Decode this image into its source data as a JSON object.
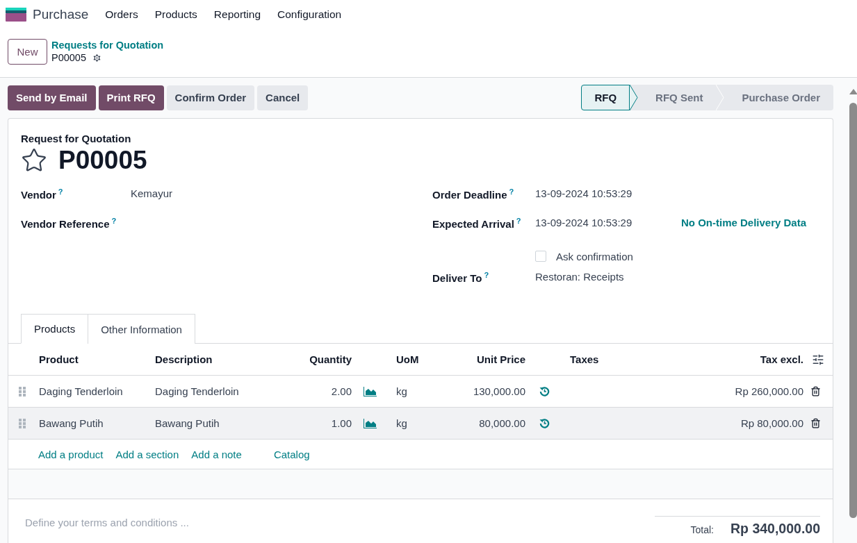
{
  "app": {
    "name": "Purchase"
  },
  "menu": [
    "Orders",
    "Products",
    "Reporting",
    "Configuration"
  ],
  "control_panel": {
    "new_button": "New",
    "breadcrumb": "Requests for Quotation",
    "record": "P00005"
  },
  "actions": [
    {
      "label": "Send by Email",
      "kind": "primary"
    },
    {
      "label": "Print RFQ",
      "kind": "primary"
    },
    {
      "label": "Confirm Order",
      "kind": "secondary"
    },
    {
      "label": "Cancel",
      "kind": "secondary"
    }
  ],
  "status_bar": [
    {
      "label": "RFQ",
      "selected": true
    },
    {
      "label": "RFQ Sent",
      "selected": false
    },
    {
      "label": "Purchase Order",
      "selected": false
    }
  ],
  "form": {
    "subtitle": "Request for Quotation",
    "title": "P00005",
    "starred": false,
    "left_fields": [
      {
        "label": "Vendor",
        "help": "?",
        "value": "Kemayur"
      },
      {
        "label": "Vendor Reference",
        "help": "?"
      }
    ],
    "right_fields": [
      {
        "label": "Order Deadline",
        "help": "?",
        "value": "13-09-2024 10:53:29"
      },
      {
        "label": "Expected Arrival",
        "help": "?",
        "value": "13-09-2024 10:53:29",
        "extra": "No On-time Delivery Data"
      },
      {
        "kind": "checkbox",
        "label": "Ask confirmation",
        "checked": false
      },
      {
        "label": "Deliver To",
        "help": "?",
        "value": "Restoran: Receipts"
      }
    ]
  },
  "tabs": [
    {
      "label": "Products",
      "selected": true
    },
    {
      "label": "Other Information",
      "selected": false
    }
  ],
  "table": {
    "columns": [
      "Product",
      "Description",
      "Quantity",
      "UoM",
      "Unit Price",
      "Taxes",
      "Tax excl."
    ],
    "rows": [
      {
        "product": "Daging Tenderloin",
        "description": "Daging Tenderloin",
        "quantity": "2.00",
        "uom": "kg",
        "unit_price": "130,000.00",
        "subtotal": "Rp 260,000.00",
        "hovered": false
      },
      {
        "product": "Bawang Putih",
        "description": "Bawang Putih",
        "quantity": "1.00",
        "uom": "kg",
        "unit_price": "80,000.00",
        "subtotal": "Rp 80,000.00",
        "hovered": true
      }
    ],
    "add_links": [
      "Add a product",
      "Add a section",
      "Add a note",
      "Catalog"
    ]
  },
  "terms": {
    "placeholder": "Define your terms and conditions ..."
  },
  "total": {
    "label": "Total:",
    "value": "Rp 340,000.00"
  }
}
